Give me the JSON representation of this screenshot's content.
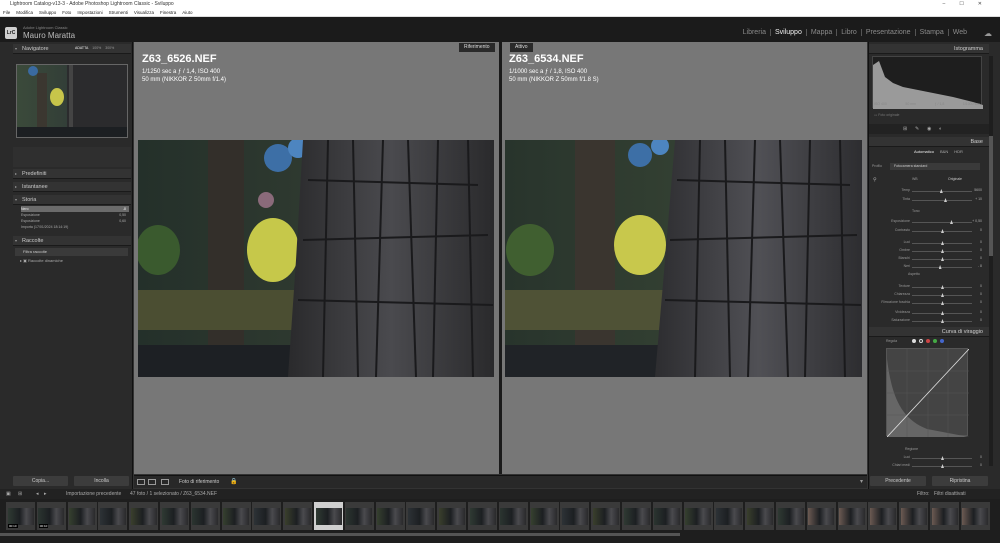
{
  "window": {
    "title": "Lightroom Catalog-v13-3 - Adobe Photoshop Lightroom Classic - Sviluppo"
  },
  "menu": [
    "File",
    "Modifica",
    "Sviluppo",
    "Foto",
    "Impostazioni",
    "Strumenti",
    "Visualizza",
    "Finestra",
    "Aiuto"
  ],
  "identity": {
    "logo": "LrC",
    "app": "Adobe Lightroom Classic",
    "user": "Mauro Maratta"
  },
  "modules": [
    "Libreria",
    "Sviluppo",
    "Mappa",
    "Libro",
    "Presentazione",
    "Stampa",
    "Web"
  ],
  "left": {
    "navigator": "Navigatore",
    "zoom": [
      "ADATTA",
      "100%",
      "300%"
    ],
    "presets": "Predefiniti",
    "snapshots": "Istantanee",
    "history": "Storia",
    "history_items": [
      "Nero",
      "Esposizione",
      "Esposizione",
      "Importa (17/01/2024 18:14:19)"
    ],
    "history_values": [
      "-8",
      "0,50",
      "0,60",
      ""
    ],
    "collections": "Raccolte",
    "collection_items": [
      "Filtra raccolte",
      "Raccolte dinamiche"
    ],
    "copy": "Copia...",
    "paste": "Incolla"
  },
  "center": {
    "ref_tag": "Riferimento",
    "active_tag": "Attivo",
    "left_file": "Z63_6526.NEF",
    "left_info1": "1/1250 sec a ƒ / 1,4, ISO 400",
    "left_info2": "50 mm (NIKKOR Z 50mm f/1.4)",
    "right_file": "Z63_6534.NEF",
    "right_info1": "1/1000 sec a ƒ / 1,8, ISO 400",
    "right_info2": "50 mm (NIKKOR Z 50mm f/1.8 S)",
    "toolbar_label": "Foto di riferimento"
  },
  "right": {
    "histogram": "Istogramma",
    "hist_info": [
      "ISO 400",
      "50 mm",
      "ƒ / 1,8",
      "1/1000 sec"
    ],
    "orig_label": "Foto originale",
    "basic": "Base",
    "treat": [
      "Automatico",
      "B&N",
      "HDR"
    ],
    "profile_label": "Profilo",
    "profile_value": "Fotocamera standard",
    "wb_label": "Originale",
    "wb_name": "WB",
    "tone": "Tono",
    "presence": "Aspetto",
    "sliders": [
      {
        "l": "Temp",
        "v": "5600"
      },
      {
        "l": "Tinta",
        "v": "+ 10"
      },
      {
        "l": "Esposizione",
        "v": "+ 0,50"
      },
      {
        "l": "Contrasto",
        "v": "0"
      },
      {
        "l": "Luci",
        "v": "0"
      },
      {
        "l": "Ombre",
        "v": "0"
      },
      {
        "l": "Bianchi",
        "v": "0"
      },
      {
        "l": "Neri",
        "v": "- 8"
      },
      {
        "l": "Texture",
        "v": "0"
      },
      {
        "l": "Chiarezza",
        "v": "0"
      },
      {
        "l": "Rimozione foschia",
        "v": "0"
      },
      {
        "l": "Vividezza",
        "v": "0"
      },
      {
        "l": "Saturazione",
        "v": "0"
      }
    ],
    "curve": "Curva di viraggio",
    "curve_label": "Regola",
    "region": "Regione",
    "region_sliders": [
      {
        "l": "Luci",
        "v": "0"
      },
      {
        "l": "Chiari medi",
        "v": "0"
      }
    ],
    "prev": "Precedente",
    "reset": "Ripristina"
  },
  "filmbar": {
    "source": "Importazione precedente",
    "count": "47 foto / 1 selezionato / Z63_6534.NEF",
    "filter_label": "Filtro:",
    "filter_value": "Filtri disattivati"
  },
  "filmstrip": {
    "badges": [
      "00:10",
      "00:10"
    ]
  },
  "colors": {
    "accent": "#f0f0f0",
    "panel": "#2a2a2a",
    "canvas": "#777777"
  }
}
